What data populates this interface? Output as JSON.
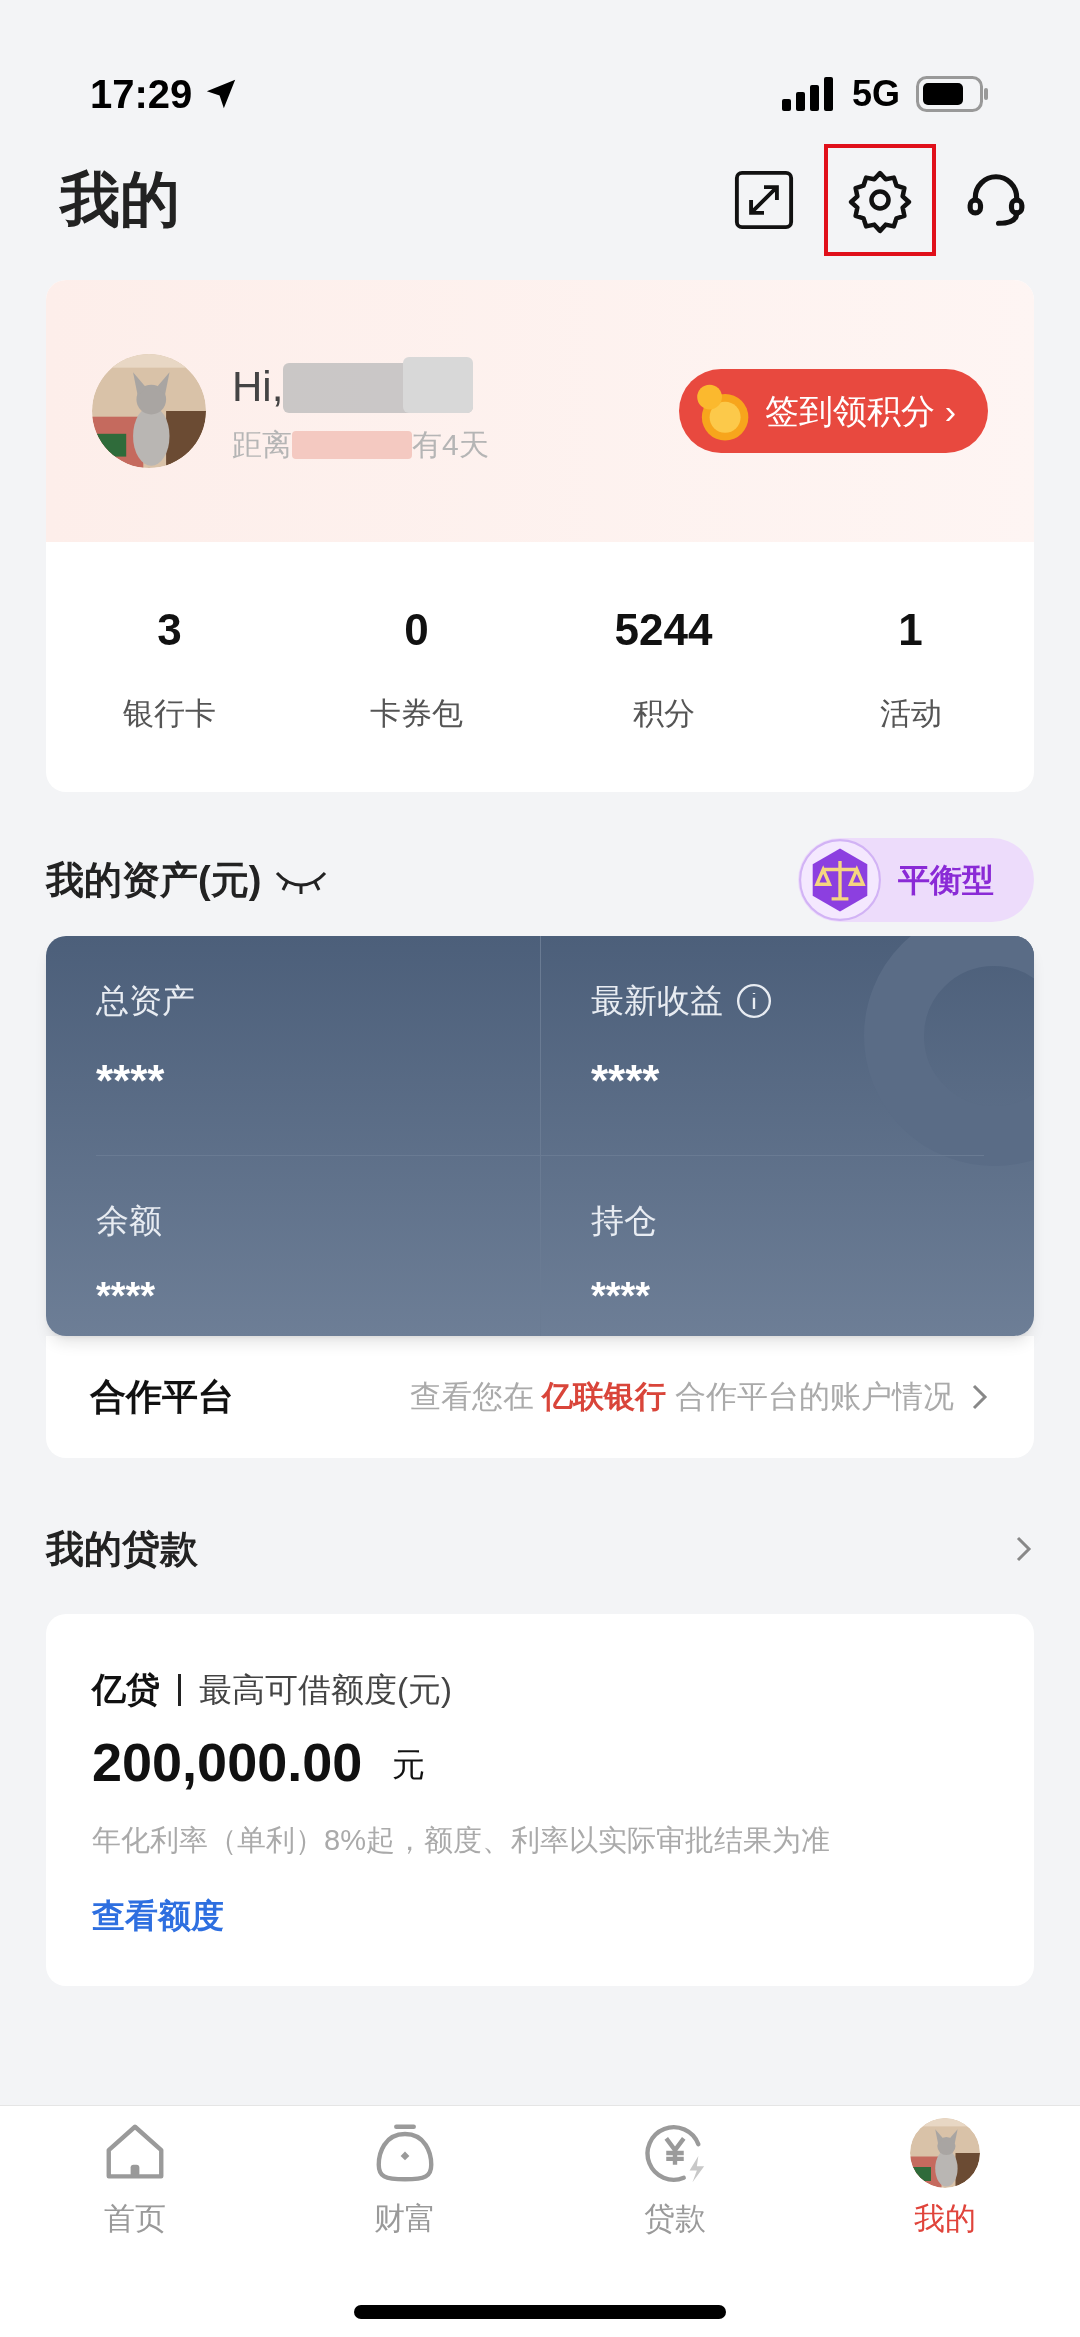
{
  "status_bar": {
    "time": "17:29",
    "network": "5G"
  },
  "header": {
    "title": "我的"
  },
  "profile": {
    "greeting": "Hi,",
    "subtitle_start": "距离",
    "subtitle_end": "有4天",
    "checkin_button": "签到领积分 ›"
  },
  "stats": [
    {
      "value": "3",
      "label": "银行卡"
    },
    {
      "value": "0",
      "label": "卡券包"
    },
    {
      "value": "5244",
      "label": "积分"
    },
    {
      "value": "1",
      "label": "活动"
    }
  ],
  "assets": {
    "title": "我的资产(元)",
    "risk_badge": "平衡型",
    "cells": [
      {
        "label": "总资产",
        "value": "****",
        "info": false
      },
      {
        "label": "最新收益",
        "value": "****",
        "info": true
      },
      {
        "label": "余额",
        "value": "****",
        "info": false
      },
      {
        "label": "持仓",
        "value": "****",
        "info": false
      }
    ],
    "partner": {
      "title": "合作平台",
      "description": "查看您在 **亿联银行** 合作平台的账户情况"
    }
  },
  "loans": {
    "title": "我的贷款",
    "product": "亿贷",
    "limit_label": "最高可借额度(元)",
    "amount": "200,000.00",
    "unit": "元",
    "note": "年化利率（单利）8%起，额度、利率以实际审批结果为准",
    "link": "查看额度"
  },
  "tab_bar": [
    {
      "kind": "home",
      "label": "首页",
      "selected": false
    },
    {
      "kind": "wealth",
      "label": "财富",
      "selected": false
    },
    {
      "kind": "loan",
      "label": "贷款",
      "selected": false
    },
    {
      "kind": "avatar",
      "label": "我的",
      "selected": true
    }
  ]
}
